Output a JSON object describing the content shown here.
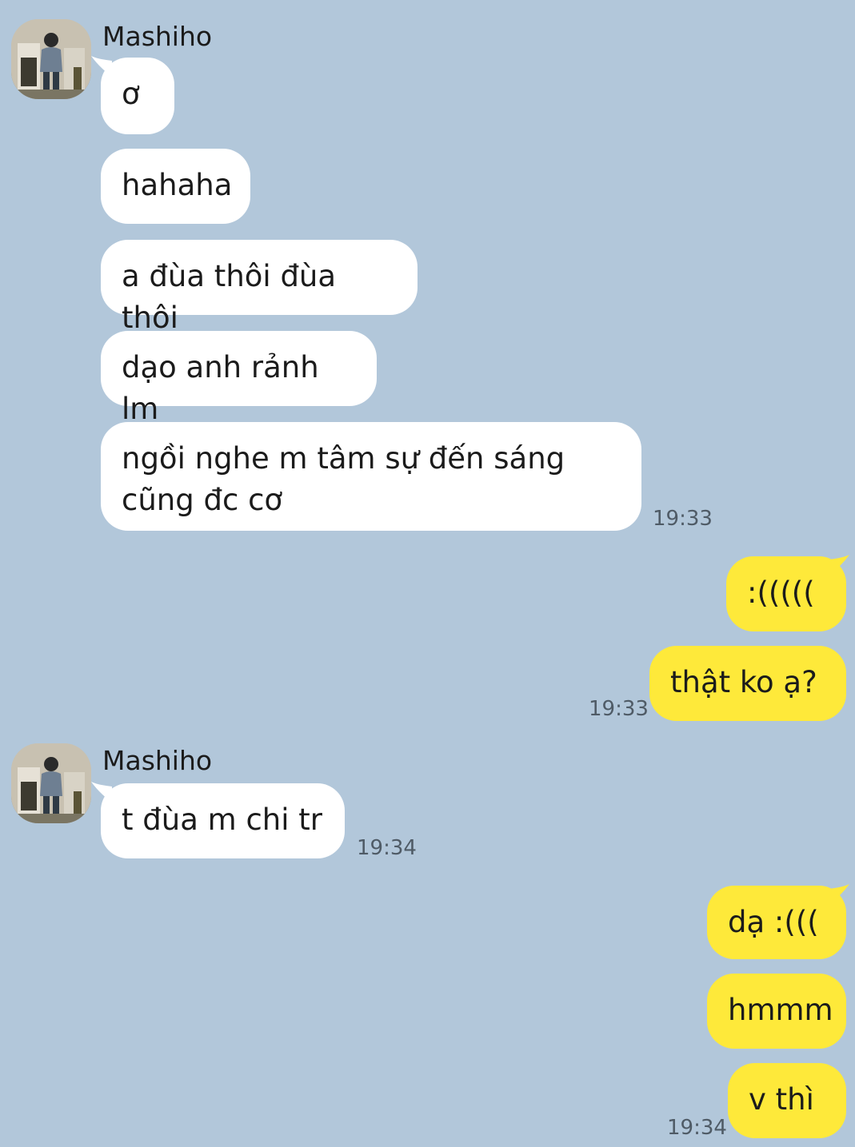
{
  "contact": {
    "name": "Mashiho"
  },
  "messages": [
    {
      "text": "ơ"
    },
    {
      "text": "hahaha"
    },
    {
      "text": "a đùa thôi đùa thôi"
    },
    {
      "text": "dạo anh rảnh lm"
    },
    {
      "text": "ngồi nghe m tâm sự đến sáng\ncũng đc cơ",
      "time": "19:33"
    },
    {
      "text": ":((((("
    },
    {
      "text": "thật ko ạ?",
      "time": "19:33"
    },
    {
      "text": "t đùa m chi tr",
      "time": "19:34"
    },
    {
      "text": "dạ :((("
    },
    {
      "text": "hmmm"
    },
    {
      "text": "v thì",
      "time": "19:34"
    }
  ],
  "colors": {
    "background": "#b2c7da",
    "incoming_bubble": "#ffffff",
    "outgoing_bubble": "#fee93a",
    "timestamp": "#4f5b66"
  }
}
